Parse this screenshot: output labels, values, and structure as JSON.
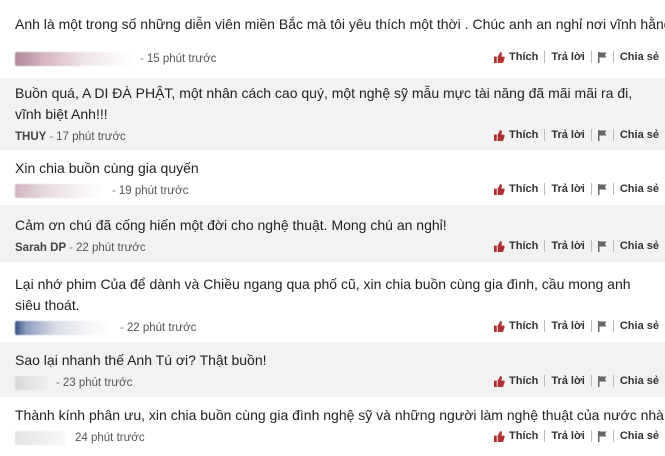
{
  "actions": {
    "like": "Thích",
    "reply": "Trả lời",
    "share": "Chia sẻ",
    "like_icon": "thumbs-up-icon",
    "flag_icon": "flag-icon"
  },
  "comments": [
    {
      "text": "Anh là một trong số những diễn viên miền Bắc mà tôi yêu thích một thời . Chúc anh an nghỉ nơi vĩnh hằng .",
      "author": "",
      "time": "15 phút trước",
      "avatar_color": "#c8a2b0"
    },
    {
      "text": "Buồn quá, A DI ĐÀ PHẬT, một nhân cách cao quý, một nghệ sỹ mẫu mực tài năng đã mãi mãi ra đi, vĩnh biệt Anh!!!",
      "author": "THUY",
      "time": "17 phút trước",
      "avatar_color": ""
    },
    {
      "text": "Xin chia buồn cùng gia quyến",
      "author": "",
      "time": "19 phút trước",
      "avatar_color": "#d9c2cc"
    },
    {
      "text": "Cảm ơn chú đã cống hiến một đời cho nghệ thuật. Mong chú an nghỉ!",
      "author": "Sarah DP",
      "time": "22 phút trước",
      "avatar_color": ""
    },
    {
      "text": "Lại nhớ phim Của để dành và Chiều ngang qua phố cũ, xin chia buồn cùng gia đình, cầu mong anh siêu thoát.",
      "author": "",
      "time": "22 phút trước",
      "avatar_color": "#b9c4d6"
    },
    {
      "text": "Sao lại nhanh thế Anh Tú ơi? Thật buồn!",
      "author": "",
      "time": "23 phút trước",
      "avatar_color": "#e2e2e2"
    },
    {
      "text": "Thành kính phân ưu, xin chia buồn cùng gia đình nghệ sỹ và những người làm nghệ thuật của nước nhà",
      "author": "",
      "time": "24 phút trước",
      "avatar_color": "#ececec"
    }
  ]
}
